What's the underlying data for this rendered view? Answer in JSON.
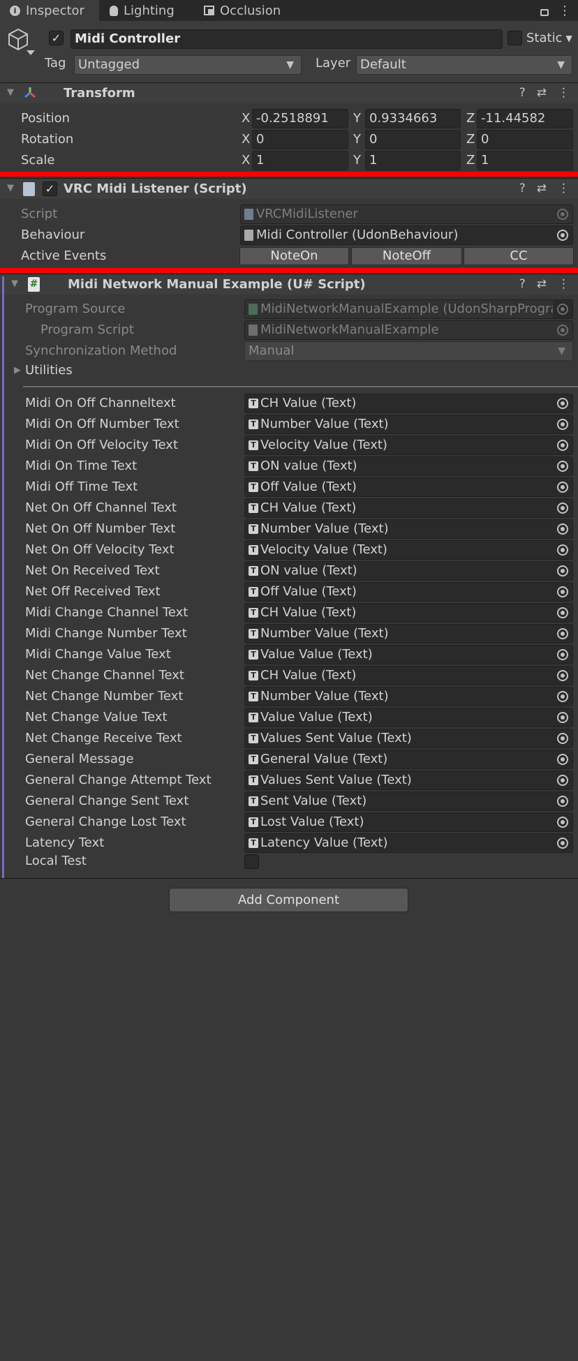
{
  "tabs": [
    {
      "label": "Inspector",
      "icon": "info-icon"
    },
    {
      "label": "Lighting",
      "icon": "lightbulb-icon"
    },
    {
      "label": "Occlusion",
      "icon": "occlusion-icon"
    }
  ],
  "header": {
    "object_name": "Midi Controller",
    "static_label": "Static",
    "tag_label": "Tag",
    "tag_value": "Untagged",
    "layer_label": "Layer",
    "layer_value": "Default"
  },
  "transform": {
    "title": "Transform",
    "rows": [
      {
        "label": "Position",
        "x": "-0.2518891",
        "y": "0.9334663",
        "z": "-11.44582"
      },
      {
        "label": "Rotation",
        "x": "0",
        "y": "0",
        "z": "0"
      },
      {
        "label": "Scale",
        "x": "1",
        "y": "1",
        "z": "1"
      }
    ],
    "axis_x": "X",
    "axis_y": "Y",
    "axis_z": "Z"
  },
  "midi_listener": {
    "title": "VRC Midi Listener (Script)",
    "script_label": "Script",
    "script_value": "VRCMidiListener",
    "behaviour_label": "Behaviour",
    "behaviour_value": "Midi Controller (UdonBehaviour)",
    "events_label": "Active Events",
    "events": [
      "NoteOn",
      "NoteOff",
      "CC"
    ]
  },
  "udon": {
    "title": "Midi Network Manual Example (U# Script)",
    "program_source_label": "Program Source",
    "program_source_value": "MidiNetworkManualExample (UdonSharpProgram",
    "program_script_label": "Program Script",
    "program_script_value": "MidiNetworkManualExample",
    "sync_label": "Synchronization Method",
    "sync_value": "Manual",
    "utilities_label": "Utilities",
    "fields": [
      {
        "label": "Midi On Off Channeltext",
        "value": "CH Value (Text)"
      },
      {
        "label": "Midi On Off Number Text",
        "value": "Number Value (Text)"
      },
      {
        "label": "Midi On Off Velocity Text",
        "value": "Velocity Value (Text)"
      },
      {
        "label": "Midi On Time Text",
        "value": "ON value (Text)"
      },
      {
        "label": "Midi Off Time Text",
        "value": "Off Value (Text)"
      },
      {
        "label": "Net On Off Channel Text",
        "value": "CH Value (Text)"
      },
      {
        "label": "Net On Off Number Text",
        "value": "Number Value (Text)"
      },
      {
        "label": "Net On Off Velocity Text",
        "value": "Velocity Value (Text)"
      },
      {
        "label": "Net On Received Text",
        "value": "ON value (Text)"
      },
      {
        "label": "Net Off Received Text",
        "value": "Off Value (Text)"
      },
      {
        "label": "Midi Change Channel Text",
        "value": "CH Value (Text)"
      },
      {
        "label": "Midi Change Number Text",
        "value": "Number Value (Text)"
      },
      {
        "label": "Midi Change Value Text",
        "value": "Value Value (Text)"
      },
      {
        "label": "Net Change Channel Text",
        "value": "CH Value (Text)"
      },
      {
        "label": "Net Change Number Text",
        "value": "Number Value (Text)"
      },
      {
        "label": "Net Change Value Text",
        "value": "Value Value (Text)"
      },
      {
        "label": "Net Change Receive Text",
        "value": "Values Sent Value (Text)"
      },
      {
        "label": "General Message",
        "value": "General Value (Text)"
      },
      {
        "label": "General Change Attempt Text",
        "value": "Values Sent Value (Text)"
      },
      {
        "label": "General Change Sent Text",
        "value": "Sent Value (Text)"
      },
      {
        "label": "General Change Lost Text",
        "value": "Lost Value (Text)"
      },
      {
        "label": "Latency Text",
        "value": "Latency Value (Text)"
      }
    ],
    "local_test_label": "Local Test"
  },
  "add_component_label": "Add Component"
}
